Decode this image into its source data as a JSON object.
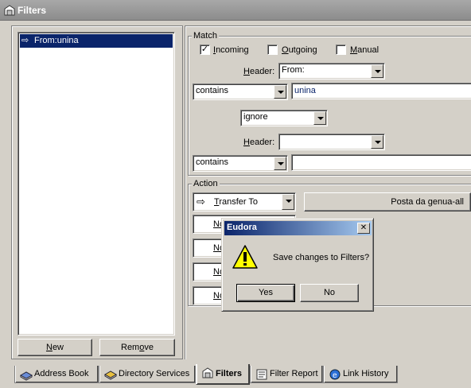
{
  "window": {
    "title": "Filters"
  },
  "filters_list": {
    "items": [
      {
        "label": "From:unina"
      }
    ]
  },
  "left_buttons": {
    "new_prefix": "",
    "new_key": "N",
    "new_rest": "ew",
    "remove_pre": "Rem",
    "remove_key": "o",
    "remove_rest": "ve"
  },
  "match": {
    "group_label": "Match",
    "incoming": {
      "label_key": "I",
      "label_rest": "ncoming",
      "checked": true
    },
    "outgoing": {
      "label_key": "O",
      "label_rest": "utgoing",
      "checked": false
    },
    "manual": {
      "label_key": "M",
      "label_rest": "anual",
      "checked": false
    },
    "header1_key": "H",
    "header1_rest": "eader:",
    "header1_value": "From:",
    "condition1": "contains",
    "value1": "unina",
    "conjunction": "ignore",
    "header2_key": "H",
    "header2_rest": "eader:",
    "header2_value": "",
    "condition2": "contains",
    "value2": ""
  },
  "action": {
    "group_label": "Action",
    "action1_key": "T",
    "action1_rest": "ransfer To",
    "target1": "Posta da genua-all",
    "none_rows": [
      "No",
      "No",
      "No",
      "No"
    ]
  },
  "tabs": [
    {
      "label": "Address Book",
      "icon": "address-book-icon",
      "active": false
    },
    {
      "label": "Directory Services",
      "icon": "directory-services-icon",
      "active": false
    },
    {
      "label": "Filters",
      "icon": "filters-icon",
      "active": true
    },
    {
      "label": "Filter Report",
      "icon": "filter-report-icon",
      "active": false
    },
    {
      "label": "Link History",
      "icon": "link-history-icon",
      "active": false
    }
  ],
  "dialog": {
    "title": "Eudora",
    "message": "Save changes to Filters?",
    "yes_label": "Yes",
    "no_label": "No",
    "icon": "warning-icon"
  }
}
